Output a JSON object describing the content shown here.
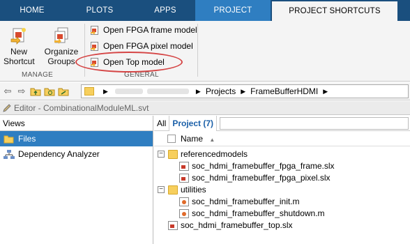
{
  "tabs": {
    "home": "HOME",
    "plots": "PLOTS",
    "apps": "APPS",
    "project": "PROJECT",
    "shortcuts": "PROJECT SHORTCUTS"
  },
  "ribbon": {
    "new_shortcut": "New\nShortcut",
    "new_shortcut_l1": "New",
    "new_shortcut_l2": "Shortcut",
    "organize_l1": "Organize",
    "organize_l2": "Groups",
    "manage_label": "MANAGE",
    "general_label": "GENERAL",
    "shortcuts": [
      "Open FPGA frame model",
      "Open FPGA pixel model",
      "Open Top model"
    ]
  },
  "address": {
    "crumbs": [
      "Projects",
      "FrameBufferHDMI"
    ]
  },
  "editor": {
    "title": "Editor - CombinationalModuleML.svt"
  },
  "views": {
    "header": "Views",
    "items": [
      "Files",
      "Dependency Analyzer"
    ]
  },
  "project": {
    "tab_all": "All",
    "tab_project": "Project (7)",
    "column_name": "Name",
    "tree": [
      {
        "label": "referencedmodels",
        "type": "folder"
      },
      {
        "label": "soc_hdmi_framebuffer_fpga_frame.slx",
        "type": "slx"
      },
      {
        "label": "soc_hdmi_framebuffer_fpga_pixel.slx",
        "type": "slx"
      },
      {
        "label": "utilities",
        "type": "folder"
      },
      {
        "label": "soc_hdmi_framebuffer_init.m",
        "type": "m"
      },
      {
        "label": "soc_hdmi_framebuffer_shutdown.m",
        "type": "m"
      },
      {
        "label": "soc_hdmi_framebuffer_top.slx",
        "type": "slx"
      }
    ]
  }
}
